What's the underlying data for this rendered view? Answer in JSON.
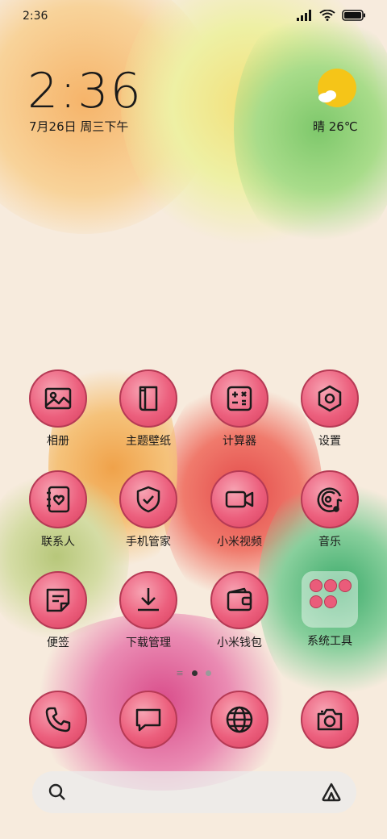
{
  "status_bar": {
    "time": "2:36"
  },
  "clock_widget": {
    "time": "2:36",
    "date": "7月26日 周三下午"
  },
  "weather_widget": {
    "text": "晴 26℃"
  },
  "apps": [
    {
      "name": "gallery",
      "label": "相册",
      "icon": "image-icon"
    },
    {
      "name": "themes",
      "label": "主题壁纸",
      "icon": "scroll-icon"
    },
    {
      "name": "calculator",
      "label": "计算器",
      "icon": "calculator-icon"
    },
    {
      "name": "settings",
      "label": "设置",
      "icon": "hexagon-nut-icon"
    },
    {
      "name": "contacts",
      "label": "联系人",
      "icon": "contact-book-icon"
    },
    {
      "name": "security",
      "label": "手机管家",
      "icon": "shield-check-icon"
    },
    {
      "name": "video",
      "label": "小米视频",
      "icon": "video-camera-icon"
    },
    {
      "name": "music",
      "label": "音乐",
      "icon": "music-disc-icon"
    },
    {
      "name": "notes",
      "label": "便签",
      "icon": "note-icon"
    },
    {
      "name": "downloads",
      "label": "下载管理",
      "icon": "download-icon"
    },
    {
      "name": "wallet",
      "label": "小米钱包",
      "icon": "wallet-icon"
    },
    {
      "name": "tools-folder",
      "label": "系统工具",
      "icon": "folder-icon"
    }
  ],
  "dock": [
    {
      "name": "phone",
      "icon": "phone-icon"
    },
    {
      "name": "messages",
      "icon": "message-icon"
    },
    {
      "name": "browser",
      "icon": "globe-icon"
    },
    {
      "name": "camera",
      "icon": "camera-icon"
    }
  ],
  "colors": {
    "icon_bubble": "#ec5f7d",
    "icon_border": "#b63a55",
    "weather_sun": "#f5c518"
  }
}
